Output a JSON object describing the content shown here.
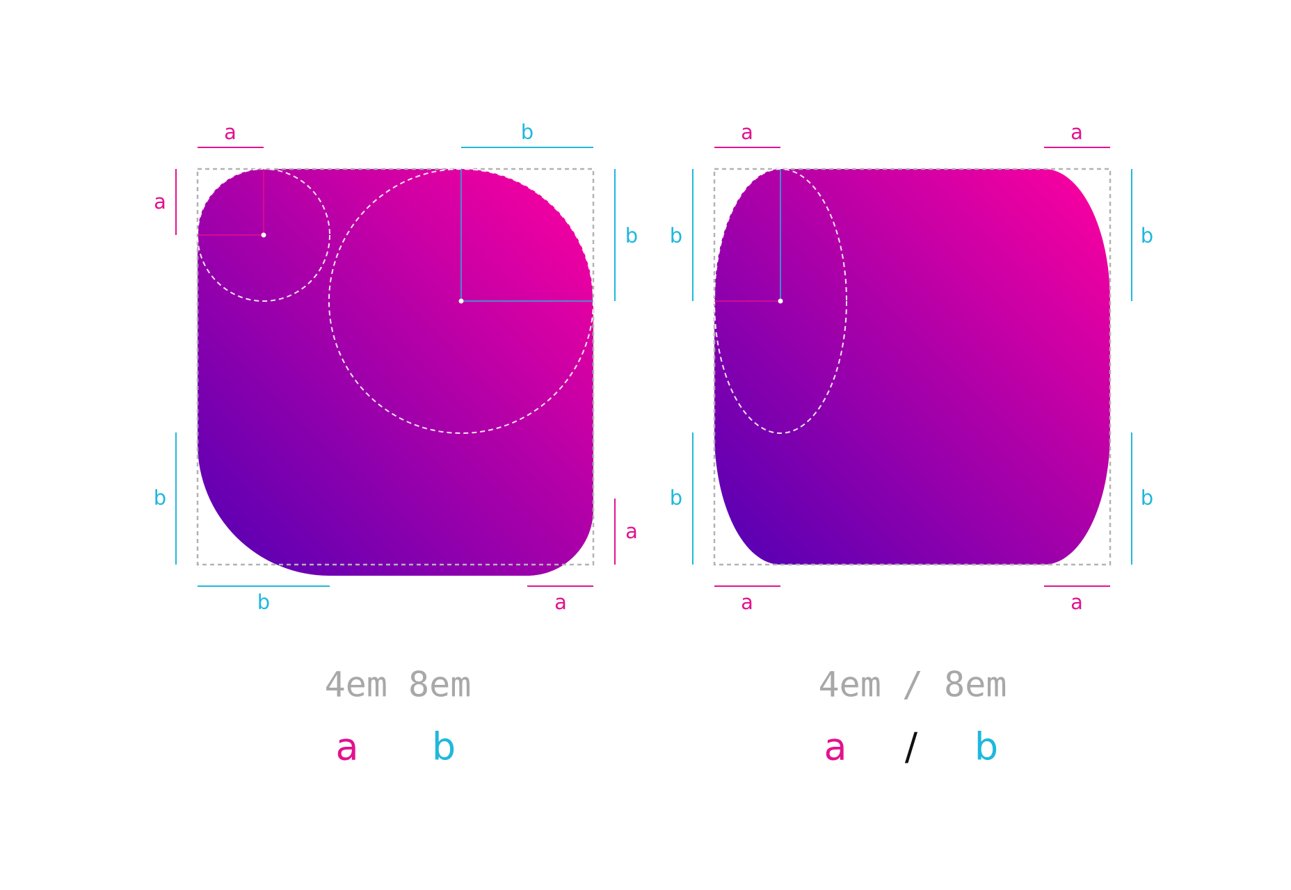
{
  "colors": {
    "a": "#e3118f",
    "b": "#1fb8dd",
    "gradient_start": "#5a00b8",
    "gradient_end": "#ff00a0",
    "guide": "#b3b3b3",
    "code_text": "#a8a8a8",
    "separator": "#111111"
  },
  "left_diagram": {
    "dimension_labels": {
      "top_left": "a",
      "top_right": "b",
      "left_top": "a",
      "left_bottom": "b",
      "right_top": "b",
      "right_bottom": "a",
      "bottom_left": "b",
      "bottom_right": "a"
    },
    "code": "4em 8em",
    "legend": {
      "first": "a",
      "second": "b"
    }
  },
  "right_diagram": {
    "dimension_labels": {
      "top_left": "a",
      "top_right": "a",
      "left_top": "b",
      "left_bottom": "b",
      "right_top": "b",
      "right_bottom": "b",
      "bottom_left": "a",
      "bottom_right": "a"
    },
    "code": "4em / 8em",
    "legend": {
      "first": "a",
      "separator": "/",
      "second": "b"
    }
  }
}
